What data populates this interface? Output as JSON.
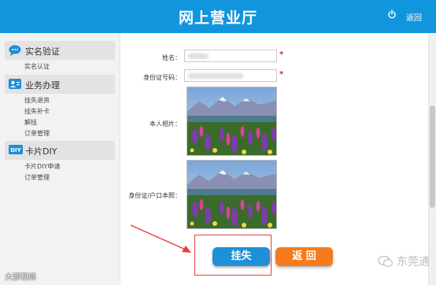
{
  "header": {
    "title": "网上营业厅",
    "back_label": "返回",
    "power_icon": "power-icon"
  },
  "sidebar": {
    "groups": [
      {
        "title": "实名验证",
        "icon": "chat-bubble-icon",
        "items": [
          "实名认证"
        ]
      },
      {
        "title": "业务办理",
        "icon": "id-card-icon",
        "items": [
          "挂失退资",
          "挂失补卡",
          "解挂",
          "订单管理"
        ]
      },
      {
        "title": "卡片DIY",
        "icon": "diy-badge-icon",
        "icon_text": "DIY",
        "items": [
          "卡片DIY申请",
          "订单管理"
        ]
      }
    ]
  },
  "form": {
    "name_label": "姓名：",
    "id_label": "身份证号码：",
    "photo_label": "本人相片：",
    "id_photo_label": "身份证/户口本照：",
    "required_mark": "*"
  },
  "buttons": {
    "report_loss": "挂失",
    "back": "返 回"
  },
  "watermark": {
    "left": "大部视商",
    "right": "东莞通"
  },
  "colors": {
    "header": "#1196dd",
    "primary_button": "#1e90d8",
    "back_button": "#f57b1c",
    "highlight_box": "#e83c3c"
  }
}
